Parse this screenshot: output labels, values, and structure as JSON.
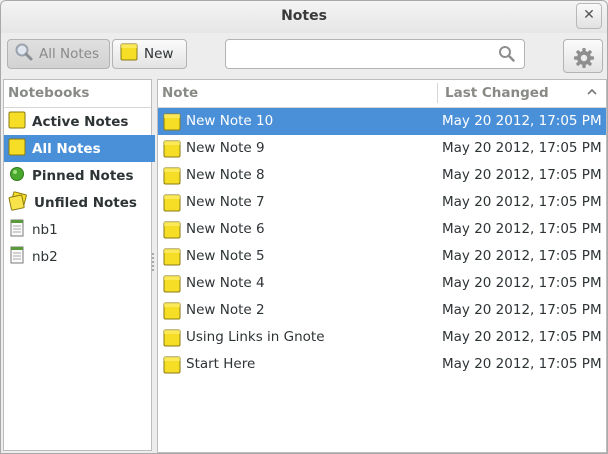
{
  "window": {
    "title": "Notes",
    "close_label": "✕"
  },
  "toolbar": {
    "all_notes_label": "All Notes",
    "new_label": "New",
    "search_placeholder": ""
  },
  "notebooks": {
    "header": "Notebooks",
    "items": [
      {
        "label": "Active Notes",
        "icon": "yellow-note-icon",
        "bold": true
      },
      {
        "label": "All Notes",
        "icon": "yellow-note-icon",
        "bold": true,
        "selected": true
      },
      {
        "label": "Pinned Notes",
        "icon": "green-pin-icon",
        "bold": true
      },
      {
        "label": "Unfiled Notes",
        "icon": "unfiled-notes-icon",
        "bold": true
      },
      {
        "label": "nb1",
        "icon": "notebook-icon",
        "bold": false
      },
      {
        "label": "nb2",
        "icon": "notebook-icon",
        "bold": false
      }
    ]
  },
  "notes": {
    "col_note": "Note",
    "col_changed": "Last Changed",
    "rows": [
      {
        "title": "New Note 10",
        "changed": "May 20 2012, 17:05 PM",
        "selected": true
      },
      {
        "title": "New Note 9",
        "changed": "May 20 2012, 17:05 PM"
      },
      {
        "title": "New Note 8",
        "changed": "May 20 2012, 17:05 PM"
      },
      {
        "title": "New Note 7",
        "changed": "May 20 2012, 17:05 PM"
      },
      {
        "title": "New Note 6",
        "changed": "May 20 2012, 17:05 PM"
      },
      {
        "title": "New Note 5",
        "changed": "May 20 2012, 17:05 PM"
      },
      {
        "title": "New Note 4",
        "changed": "May 20 2012, 17:05 PM"
      },
      {
        "title": "New Note 2",
        "changed": "May 20 2012, 17:05 PM"
      },
      {
        "title": "Using Links in Gnote",
        "changed": "May 20 2012, 17:05 PM"
      },
      {
        "title": "Start Here",
        "changed": "May 20 2012, 17:05 PM"
      }
    ]
  },
  "colors": {
    "selection": "#4a90d9",
    "note_yellow": "#f5d800",
    "pin_green": "#4aa82e"
  }
}
